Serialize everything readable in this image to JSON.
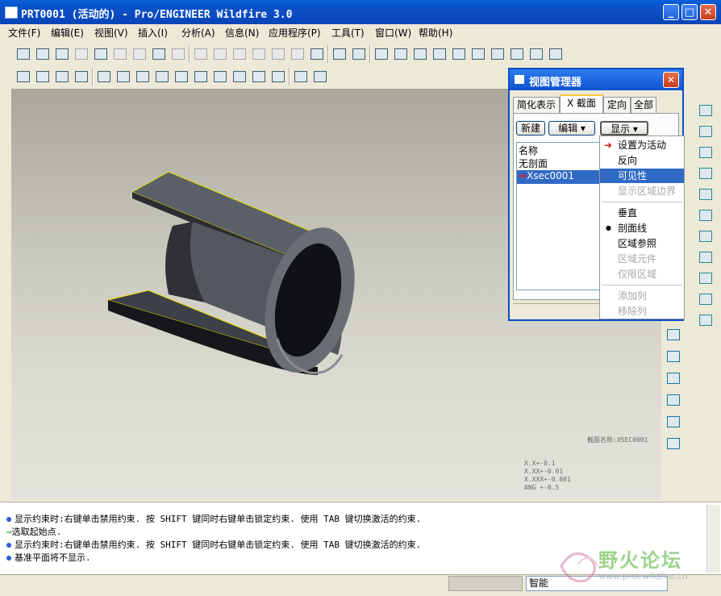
{
  "window": {
    "title": "PRT0001 (活动的) - Pro/ENGINEER Wildfire 3.0"
  },
  "menu": [
    "文件(F)",
    "编辑(E)",
    "视图(V)",
    "插入(I)",
    "分析(A)",
    "信息(N)",
    "应用程序(P)",
    "工具(T)",
    "窗口(W)",
    "帮助(H)"
  ],
  "toolbar_icons_top": [
    "new-icon",
    "open-icon",
    "save-icon",
    "save-copy-icon",
    "print-icon",
    "send-icon",
    "erase-icon",
    "regenerate-icon",
    "model-player-icon",
    "undo-icon",
    "redo-icon",
    "cut-icon",
    "copy-icon",
    "paste-icon",
    "paste-special-icon",
    "regen-manager-icon",
    "find-icon",
    "select-box-icon",
    "view-orient-icon",
    "spin-center-icon",
    "refit-icon",
    "zoom-in-icon",
    "zoom-out-icon",
    "zoom-fit-icon",
    "reorient-icon",
    "named-views-icon",
    "layers-icon",
    "view-manager-icon"
  ],
  "toolbar_icons_second": [
    "wireframe-icon",
    "hidden-line-icon",
    "no-hidden-icon",
    "shading-icon",
    "datum-plane-display-icon",
    "datum-axis-display-icon",
    "point-display-icon",
    "csys-display-icon",
    "dimension-icon",
    "annotation-icon",
    "tolerance-icon",
    "angle-icon",
    "symbol-icon",
    "repaint-icon",
    "close-window-icon",
    "whats-this-icon"
  ],
  "view_manager": {
    "title": "视图管理器",
    "tabs": [
      "简化表示",
      "X 截面",
      "定向",
      "全部"
    ],
    "active_tab": "X 截面",
    "buttons": {
      "new": "新建",
      "edit": "编辑",
      "display": "显示"
    },
    "list": {
      "header": "名称",
      "items": [
        "无剖面",
        "Xsec0001"
      ],
      "selected": "Xsec0001"
    }
  },
  "context_menu": {
    "items": [
      {
        "label": "设置为活动",
        "enabled": true,
        "marker": "arrow"
      },
      {
        "label": "反向",
        "enabled": true
      },
      {
        "label": "可见性",
        "enabled": true,
        "highlighted": true
      },
      {
        "label": "显示区域边界",
        "enabled": false
      },
      {
        "label": "垂直",
        "enabled": true
      },
      {
        "label": "剖面线",
        "enabled": true,
        "marker": "dot"
      },
      {
        "label": "区域参照",
        "enabled": true
      },
      {
        "label": "区域元件",
        "enabled": false
      },
      {
        "label": "仅限区域",
        "enabled": false
      },
      {
        "label": "添加列",
        "enabled": false
      },
      {
        "label": "移除列",
        "enabled": false
      }
    ]
  },
  "canvas": {
    "section_label": "截面名称:XSEC0001",
    "tolerances": [
      "X.X+-0.1",
      "X.XX+-0.01",
      "X.XXX+-0.001",
      "ANG +-0.5"
    ]
  },
  "messages": [
    {
      "icon": "bullet",
      "text": "显示约束时:右键单击禁用约束. 按 SHIFT 键同时右键单击锁定约束. 使用 TAB 键切换激活的约束."
    },
    {
      "icon": "arrow",
      "text": "选取起始点."
    },
    {
      "icon": "bullet",
      "text": "显示约束时:右键单击禁用约束. 按 SHIFT 键同时右键单击锁定约束. 使用 TAB 键切换激活的约束."
    },
    {
      "icon": "bullet",
      "text": "基准平面将不显示."
    }
  ],
  "status": {
    "filter": "智能"
  },
  "watermark": {
    "text": "野火论坛",
    "url": "www.proewildfire.cn"
  },
  "colors": {
    "titlebar": "#0b50c8",
    "selection": "#316ac5",
    "model_edge": "#e6e000"
  }
}
